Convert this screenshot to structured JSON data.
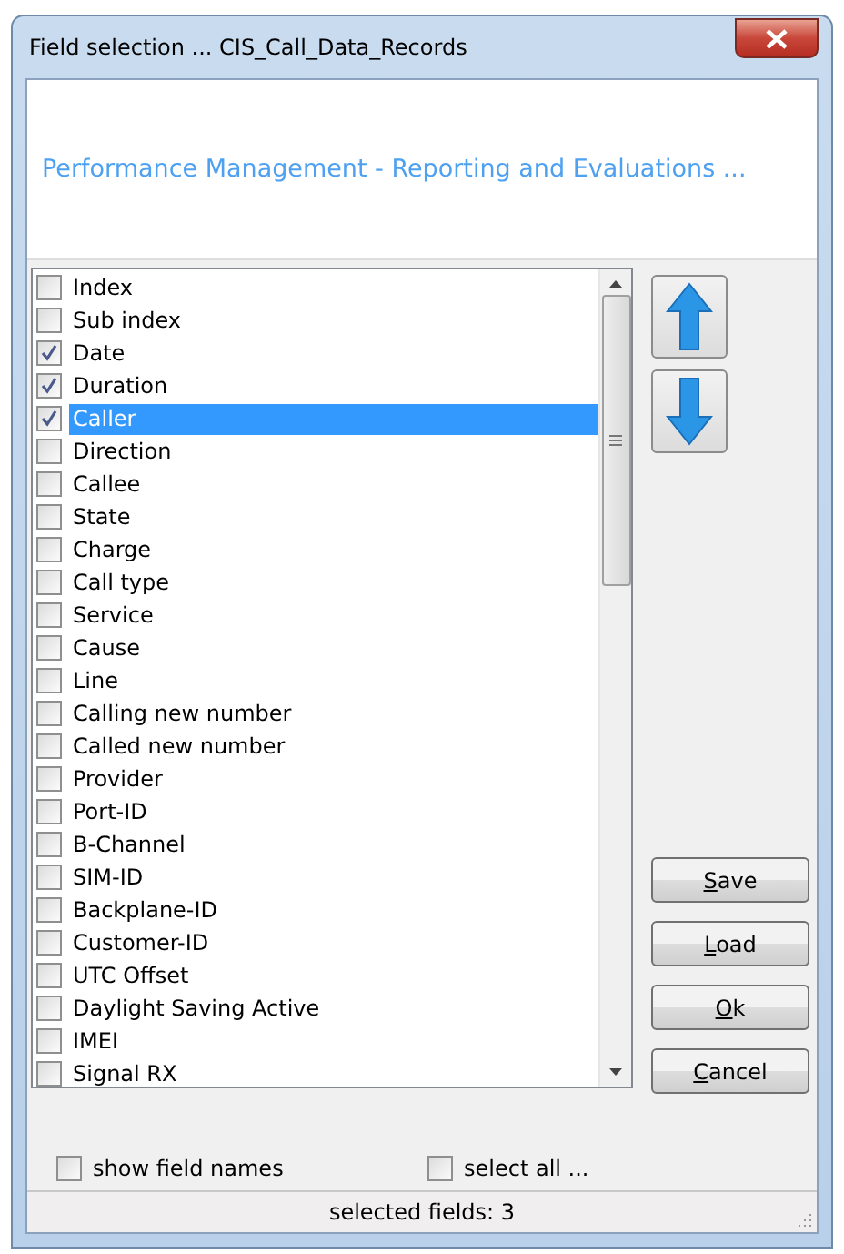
{
  "window": {
    "title": "Field selection ... CIS_Call_Data_Records"
  },
  "header": {
    "text": "Performance Management - Reporting and Evaluations ..."
  },
  "fields": [
    {
      "label": "Index",
      "checked": false,
      "selected": false
    },
    {
      "label": "Sub index",
      "checked": false,
      "selected": false
    },
    {
      "label": "Date",
      "checked": true,
      "selected": false
    },
    {
      "label": "Duration",
      "checked": true,
      "selected": false
    },
    {
      "label": "Caller",
      "checked": true,
      "selected": true
    },
    {
      "label": "Direction",
      "checked": false,
      "selected": false
    },
    {
      "label": "Callee",
      "checked": false,
      "selected": false
    },
    {
      "label": "State",
      "checked": false,
      "selected": false
    },
    {
      "label": "Charge",
      "checked": false,
      "selected": false
    },
    {
      "label": "Call type",
      "checked": false,
      "selected": false
    },
    {
      "label": "Service",
      "checked": false,
      "selected": false
    },
    {
      "label": "Cause",
      "checked": false,
      "selected": false
    },
    {
      "label": "Line",
      "checked": false,
      "selected": false
    },
    {
      "label": "Calling new number",
      "checked": false,
      "selected": false
    },
    {
      "label": "Called new number",
      "checked": false,
      "selected": false
    },
    {
      "label": "Provider",
      "checked": false,
      "selected": false
    },
    {
      "label": "Port-ID",
      "checked": false,
      "selected": false
    },
    {
      "label": "B-Channel",
      "checked": false,
      "selected": false
    },
    {
      "label": "SIM-ID",
      "checked": false,
      "selected": false
    },
    {
      "label": "Backplane-ID",
      "checked": false,
      "selected": false
    },
    {
      "label": "Customer-ID",
      "checked": false,
      "selected": false
    },
    {
      "label": "UTC Offset",
      "checked": false,
      "selected": false
    },
    {
      "label": "Daylight Saving Active",
      "checked": false,
      "selected": false
    },
    {
      "label": "IMEI",
      "checked": false,
      "selected": false
    },
    {
      "label": "Signal RX",
      "checked": false,
      "selected": false
    }
  ],
  "buttons": [
    {
      "label": "Save"
    },
    {
      "label": "Load"
    },
    {
      "label": "Ok"
    },
    {
      "label": "Cancel"
    }
  ],
  "options": [
    {
      "label": "show field names",
      "checked": false
    },
    {
      "label": "select all ...",
      "checked": false
    }
  ],
  "status_bar": {
    "text": "selected fields: 3"
  }
}
